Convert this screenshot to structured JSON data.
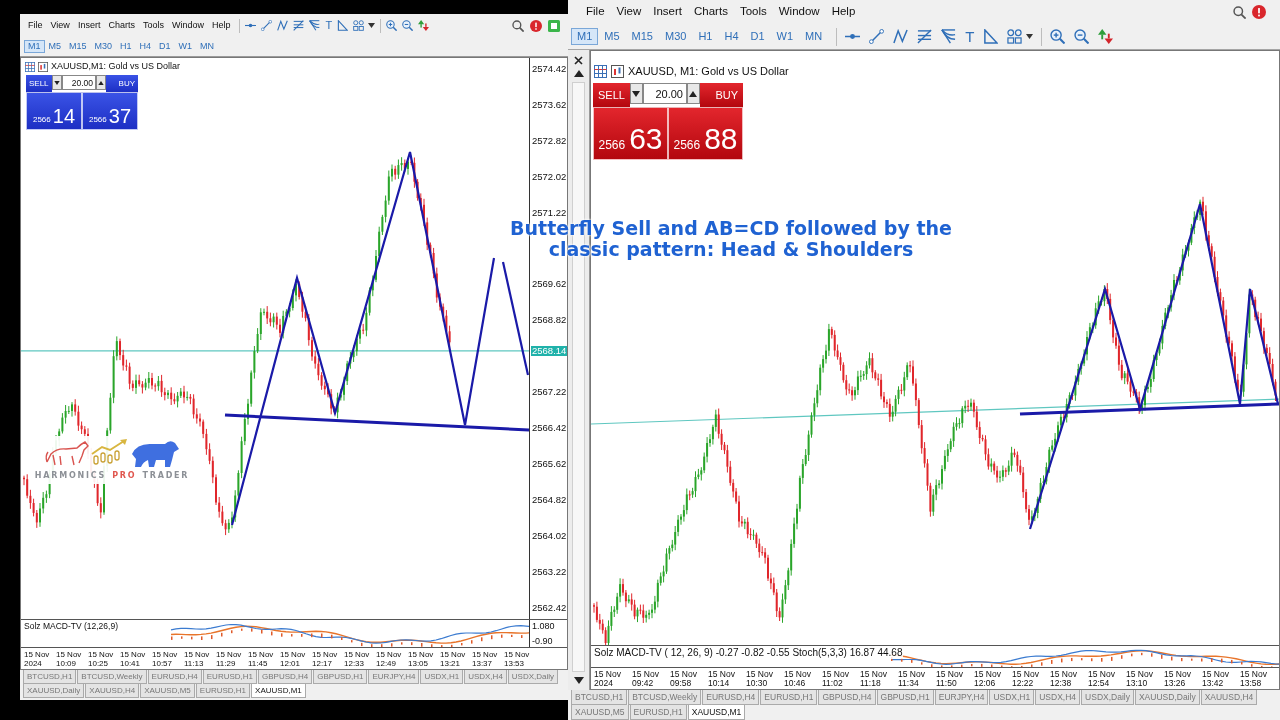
{
  "caption": {
    "lines": [
      "Butterfly Sell and AB=CD followed by the",
      "classic pattern:  Head & Shoulders"
    ]
  },
  "logo": {
    "words": [
      {
        "text": "HARMONICS",
        "color": "#8c9096"
      },
      {
        "text": "PRO",
        "color": "#e0574f"
      },
      {
        "text": "TRADER",
        "color": "#8c9096"
      }
    ]
  },
  "left_window": {
    "menu": [
      "File",
      "View",
      "Insert",
      "Charts",
      "Tools",
      "Window",
      "Help"
    ],
    "text_tool": "T",
    "timeframes": [
      {
        "label": "M1",
        "selected": true
      },
      {
        "label": "M5",
        "selected": false
      },
      {
        "label": "M15",
        "selected": false
      },
      {
        "label": "M30",
        "selected": false
      },
      {
        "label": "H1",
        "selected": false
      },
      {
        "label": "H4",
        "selected": false
      },
      {
        "label": "D1",
        "selected": false
      },
      {
        "label": "W1",
        "selected": false
      },
      {
        "label": "MN",
        "selected": false
      }
    ],
    "chart": {
      "title": "XAUUSD,M1:  Gold vs US Dollar",
      "trade_panel": {
        "sell": "SELL",
        "buy": "BUY",
        "volume": "20.00",
        "bid": {
          "figure": "2566",
          "pips": "14"
        },
        "ask": {
          "figure": "2566",
          "pips": "37"
        }
      },
      "price_labels": [
        "2574.42",
        "2573.62",
        "2572.82",
        "2572.02",
        "2571.22",
        "2569.62",
        "2568.82",
        "2567.22",
        "2566.42",
        "2565.62",
        "2564.82",
        "2564.02",
        "2563.22",
        "2562.42"
      ],
      "current_price": "2568.14",
      "indicator": {
        "label": "Solz MACD-TV (12,26,9)",
        "scale": [
          "1.080",
          "-0.90"
        ]
      },
      "time_labels": [
        "15 Nov 2024",
        "15 Nov 10:09",
        "15 Nov 10:25",
        "15 Nov 10:41",
        "15 Nov 10:57",
        "15 Nov 11:13",
        "15 Nov 11:29",
        "15 Nov 11:45",
        "15 Nov 12:01",
        "15 Nov 12:17",
        "15 Nov 12:33",
        "15 Nov 12:49",
        "15 Nov 13:05",
        "15 Nov 13:21",
        "15 Nov 13:37",
        "15 Nov 13:53"
      ]
    },
    "tabs": [
      {
        "label": "BTCUSD,H1",
        "selected": false
      },
      {
        "label": "BTCUSD,Weekly",
        "selected": false
      },
      {
        "label": "EURUSD,H4",
        "selected": false
      },
      {
        "label": "EURUSD,H1",
        "selected": false
      },
      {
        "label": "GBPUSD,H4",
        "selected": false
      },
      {
        "label": "GBPUSD,H1",
        "selected": false
      },
      {
        "label": "EURJPY,H4",
        "selected": false
      },
      {
        "label": "USDX,H1",
        "selected": false
      },
      {
        "label": "USDX,H4",
        "selected": false
      },
      {
        "label": "USDX,Daily",
        "selected": false
      },
      {
        "label": "XAUUSD,Daily",
        "selected": false
      },
      {
        "label": "XAUUSD,H4",
        "selected": false
      },
      {
        "label": "XAUUSD,M5",
        "selected": false
      },
      {
        "label": "EURUSD,H1",
        "selected": false
      },
      {
        "label": "XAUUSD,M1",
        "selected": true
      }
    ]
  },
  "right_window": {
    "menu": [
      "File",
      "View",
      "Insert",
      "Charts",
      "Tools",
      "Window",
      "Help"
    ],
    "text_tool": "T",
    "timeframes": [
      {
        "label": "M1",
        "selected": true
      },
      {
        "label": "M5",
        "selected": false
      },
      {
        "label": "M15",
        "selected": false
      },
      {
        "label": "M30",
        "selected": false
      },
      {
        "label": "H1",
        "selected": false
      },
      {
        "label": "H4",
        "selected": false
      },
      {
        "label": "D1",
        "selected": false
      },
      {
        "label": "W1",
        "selected": false
      },
      {
        "label": "MN",
        "selected": false
      }
    ],
    "chart": {
      "title": "XAUUSD, M1:  Gold vs US Dollar",
      "trade_panel": {
        "sell": "SELL",
        "buy": "BUY",
        "volume": "20.00",
        "bid": {
          "figure": "2566",
          "pips": "63"
        },
        "ask": {
          "figure": "2566",
          "pips": "88"
        }
      },
      "indicator": {
        "label": "Solz MACD-TV ( 12, 26, 9) -0.27 -0.82 -0.55 Stoch(5,3,3) 16.87 44.68"
      },
      "time_labels": [
        "15 Nov 2024",
        "15 Nov 09:42",
        "15 Nov 09:58",
        "15 Nov 10:14",
        "15 Nov 10:30",
        "15 Nov 10:46",
        "15 Nov 11:02",
        "15 Nov 11:18",
        "15 Nov 11:34",
        "15 Nov 11:50",
        "15 Nov 12:06",
        "15 Nov 12:22",
        "15 Nov 12:38",
        "15 Nov 12:54",
        "15 Nov 13:10",
        "15 Nov 13:26",
        "15 Nov 13:42",
        "15 Nov 13:58"
      ]
    },
    "tabs": [
      {
        "label": "BTCUSD,H1",
        "selected": false
      },
      {
        "label": "BTCUSD,Weekly",
        "selected": false
      },
      {
        "label": "EURUSD,H4",
        "selected": false
      },
      {
        "label": "EURUSD,H1",
        "selected": false
      },
      {
        "label": "GBPUSD,H4",
        "selected": false
      },
      {
        "label": "GBPUSD,H1",
        "selected": false
      },
      {
        "label": "EURJPY,H4",
        "selected": false
      },
      {
        "label": "USDX,H1",
        "selected": false
      },
      {
        "label": "USDX,H4",
        "selected": false
      },
      {
        "label": "USDX,Daily",
        "selected": false
      },
      {
        "label": "XAUUSD,Daily",
        "selected": false
      },
      {
        "label": "XAUUSD,H4",
        "selected": false
      },
      {
        "label": "XAUUSD,M5",
        "selected": false
      },
      {
        "label": "EURUSD,H1",
        "selected": false
      },
      {
        "label": "XAUUSD,M1",
        "selected": true
      }
    ]
  }
}
